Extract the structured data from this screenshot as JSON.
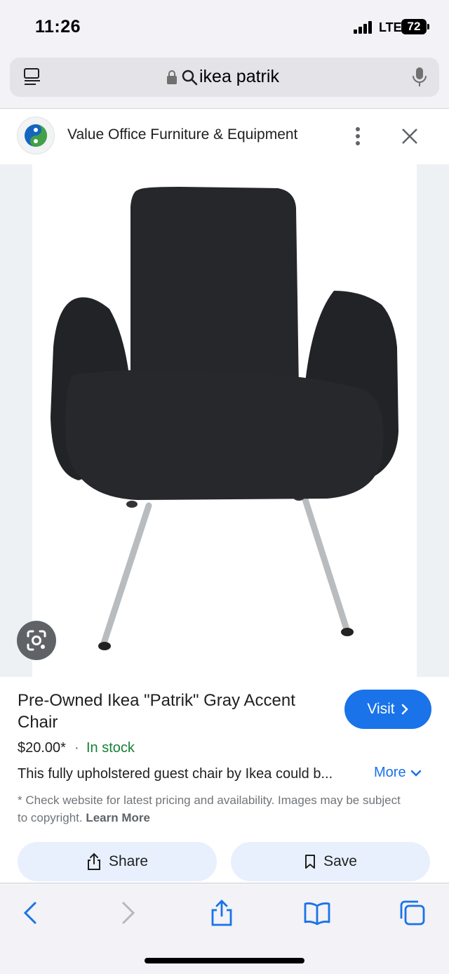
{
  "status_bar": {
    "time": "11:26",
    "network": "LTE",
    "battery": "72"
  },
  "address_bar": {
    "query": "ikea patrik"
  },
  "source": {
    "name": "Value Office Furniture & Equipment"
  },
  "product": {
    "title": "Pre-Owned Ikea \"Patrik\" Gray Accent Chair",
    "price": "$20.00*",
    "separator": "·",
    "stock_status": "In stock",
    "description": "This fully upholstered guest chair by Ikea could b...",
    "more_label": "More",
    "note_text": "* Check website for latest pricing and availability. Images may be subject to copyright.",
    "learn_more_label": "Learn More"
  },
  "buttons": {
    "visit_label": "Visit",
    "share_label": "Share",
    "save_label": "Save"
  },
  "colors": {
    "accent": "#1a73e8",
    "stock_green": "#188038",
    "chip_bg": "#e8f0fe"
  }
}
